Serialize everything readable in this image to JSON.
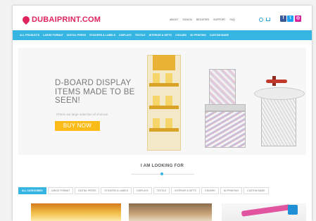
{
  "header": {
    "logo_text": "DUBAIPRINT.COM",
    "top_nav": [
      "ABOUT",
      "SIGN IN",
      "REGISTER",
      "SUPPORT",
      "FAQ"
    ],
    "social_icons": [
      "facebook-icon",
      "twitter-icon",
      "instagram-icon"
    ]
  },
  "nav": {
    "items": [
      "ALL PRODUCTS",
      "LARGE FORMAT",
      "DIGITAL PRESS",
      "STICKERS & LABELS",
      "DISPLAYS",
      "TEXTILE",
      "INTERIOR & GIFTS",
      "3 BOARD",
      "3D PRINTING",
      "CUSTOM MADE"
    ]
  },
  "hero": {
    "title": "D-BOARD DISPLAY ITEMS MADE TO BE SEEN!",
    "subtitle": "Check our large selection of choices!",
    "button": "BUY NOW"
  },
  "looking_for": {
    "title": "I AM LOOKING FOR",
    "filters": [
      "ALL CATEGORIES",
      "LARGE FORMAT",
      "DIGITAL PRESS",
      "STICKERS & LABELS",
      "DISPLAYS",
      "TEXTILE",
      "INTERIOR & GIFTS",
      "3 BOARD",
      "3D PRINTING",
      "CUSTOM MADE"
    ]
  },
  "colors": {
    "brand": "#e0245e",
    "accent": "#36b5e3",
    "button": "#fbbc1a"
  }
}
